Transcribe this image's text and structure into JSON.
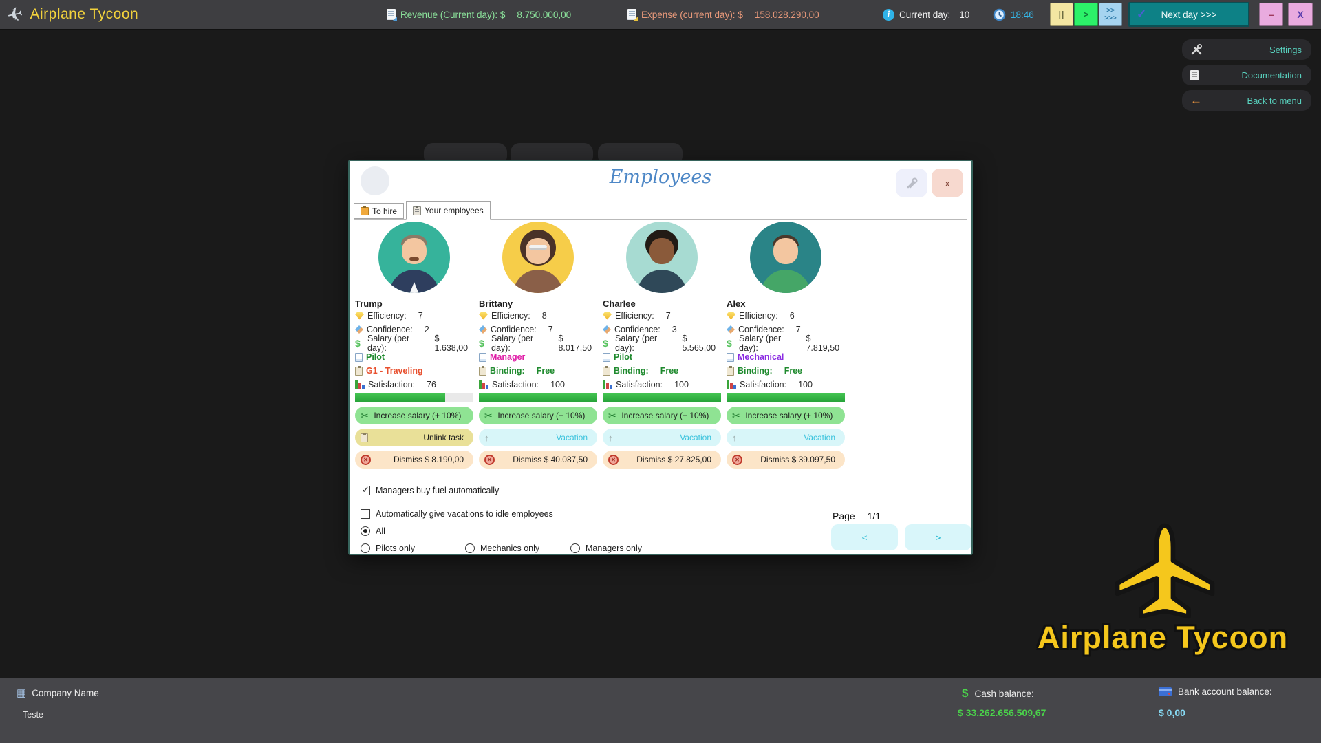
{
  "top_bar": {
    "app_title": "Airplane Tycoon",
    "revenue_label": "Revenue (Current day): $",
    "revenue_value": "8.750.000,00",
    "expense_label": "Expense (current day): $",
    "expense_value": "158.028.290,00",
    "info_glyph": "i",
    "current_day_label": "Current day:",
    "current_day_value": "10",
    "time": "18:46",
    "pause_label": "||",
    "play_label": ">",
    "fast_top": ">>",
    "fast_bottom": ">>>",
    "next_day_check": "✓",
    "next_day_label": "Next day >>>",
    "minimize_label": "–",
    "close_label": "X"
  },
  "side_menu": {
    "settings_label": "Settings",
    "documentation_label": "Documentation",
    "back_label": "Back to menu"
  },
  "dialog": {
    "title": "Employees",
    "tabs": {
      "to_hire": "To hire",
      "your_employees": "Your employees"
    },
    "close_label": "x",
    "labels": {
      "efficiency": "Efficiency:",
      "confidence": "Confidence:",
      "salary": "Salary (per day):",
      "satisfaction": "Satisfaction:"
    },
    "employees": [
      {
        "name": "Trump",
        "efficiency": "7",
        "confidence": "2",
        "salary": "$ 1.638,00",
        "role": "Pilot",
        "status_label": "G1 - Traveling",
        "status_value": "",
        "satisfaction": "76",
        "satisfaction_pct": 76,
        "increase_label": "Increase salary (+ 10%)",
        "mid_label": "Unlink task",
        "dismiss_label": "Dismiss $ 8.190,00"
      },
      {
        "name": "Brittany",
        "efficiency": "8",
        "confidence": "7",
        "salary": "$ 8.017,50",
        "role": "Manager",
        "status_label": "Binding:",
        "status_value": "Free",
        "satisfaction": "100",
        "satisfaction_pct": 100,
        "increase_label": "Increase salary (+ 10%)",
        "mid_label": "Vacation",
        "dismiss_label": "Dismiss $ 40.087,50"
      },
      {
        "name": "Charlee",
        "efficiency": "7",
        "confidence": "3",
        "salary": "$ 5.565,00",
        "role": "Pilot",
        "status_label": "Binding:",
        "status_value": "Free",
        "satisfaction": "100",
        "satisfaction_pct": 100,
        "increase_label": "Increase salary (+ 10%)",
        "mid_label": "Vacation",
        "dismiss_label": "Dismiss $ 27.825,00"
      },
      {
        "name": "Alex",
        "efficiency": "6",
        "confidence": "7",
        "salary": "$ 7.819,50",
        "role": "Mechanical",
        "status_label": "Binding:",
        "status_value": "Free",
        "satisfaction": "100",
        "satisfaction_pct": 100,
        "increase_label": "Increase salary (+ 10%)",
        "mid_label": "Vacation",
        "dismiss_label": "Dismiss $ 39.097,50"
      }
    ],
    "options": {
      "fuel_checkbox": "Managers buy fuel automatically",
      "vacations_checkbox": "Automatically give vacations to idle employees",
      "radio_all": "All",
      "radio_pilots": "Pilots only",
      "radio_mechanics": "Mechanics only",
      "radio_managers": "Managers only"
    },
    "pagination": {
      "page_label": "Page",
      "page_value": "1/1",
      "prev": "<",
      "next": ">"
    }
  },
  "bottom_bar": {
    "company_label": "Company Name",
    "company_name": "Teste",
    "cash_icon": "$",
    "cash_label": "Cash balance:",
    "cash_value": "$ 33.262.656.509,67",
    "bank_label": "Bank account balance:",
    "bank_value": "$ 0,00"
  },
  "logo": {
    "text": "Airplane Tycoon"
  },
  "colors": {
    "revenue_green": "#8ce49c",
    "expense_salmon": "#e8997a",
    "time_cyan": "#35b7e8",
    "brand_yellow": "#f2d23c",
    "menu_teal": "#58d0bd",
    "next_day_teal": "#0d8186",
    "role_pilot": "#1f8a2e",
    "role_manager": "#e020a8",
    "role_mechanical": "#8a2be2",
    "task_traveling": "#e8502e",
    "cash_green": "#4ad24a",
    "bank_blue": "#86d8f2"
  }
}
